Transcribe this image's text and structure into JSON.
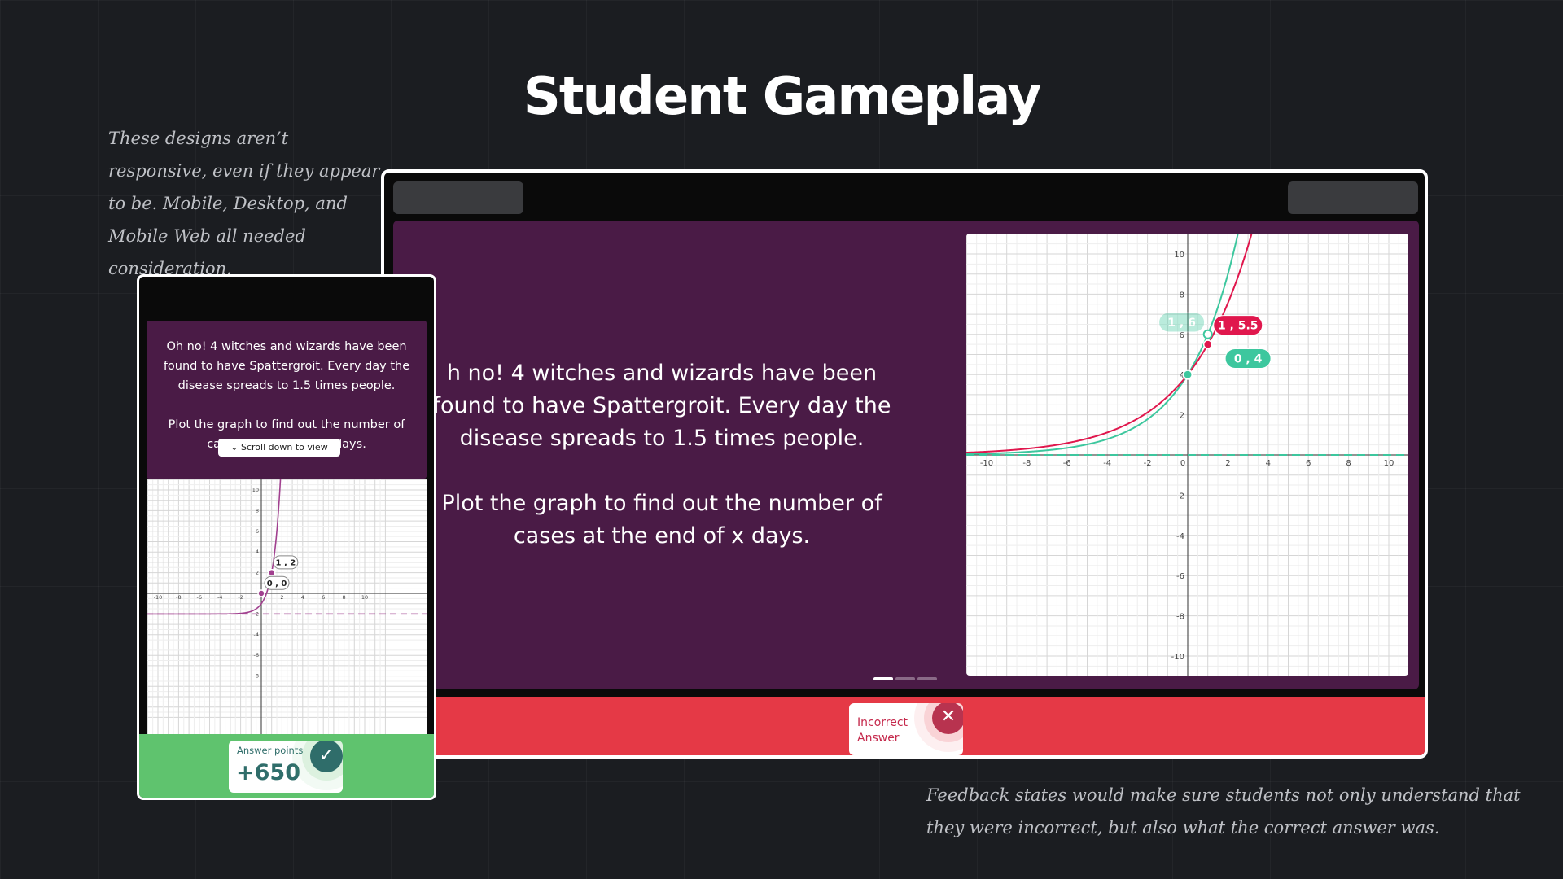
{
  "page": {
    "title": "Student Gameplay",
    "note_top_left": "These designs aren’t responsive, even if they appear to be. Mobile, Desktop, and Mobile Web all needed consideration.",
    "note_bottom_right": "Feedback states would make sure students not only understand that they were incorrect, but also what the correct answer was."
  },
  "desktop": {
    "question": "h no! 4 witches and wizards have been found to have Spattergroit. Every day the disease spreads to 1.5 times people.\n\nPlot the graph to find out the number of cases at the end of x days.",
    "graph": {
      "x_ticks": [
        "-10",
        "-8",
        "-6",
        "-4",
        "-2",
        "0",
        "2",
        "4",
        "6",
        "8",
        "10"
      ],
      "y_ticks": [
        "10",
        "8",
        "6",
        "4",
        "2",
        "-2",
        "-4",
        "-6",
        "-8",
        "-10"
      ],
      "label_correct": "0 , 4",
      "label_student": "1 , 5.5",
      "label_faded": "1 , 6"
    },
    "pagination": {
      "count": 3,
      "active_index": 0
    },
    "feedback": {
      "text": "Incorrect\nAnswer",
      "icon": "close-icon",
      "color": "#e53946"
    }
  },
  "mobile": {
    "question": "Oh no! 4 witches and wizards have been found to have Spattergroit. Every day the disease spreads to 1.5 times people.\n\nPlot the graph to find out the number of cases at the end of x days.",
    "scroll_hint": "Scroll down to view",
    "graph": {
      "x_ticks": [
        "-10",
        "-8",
        "-6",
        "-4",
        "-2",
        "2",
        "4",
        "6",
        "8",
        "10"
      ],
      "y_ticks": [
        "10",
        "8",
        "6",
        "4",
        "2",
        "-2",
        "-4",
        "-6",
        "-8"
      ],
      "label_point1": "1 , 2",
      "label_point2": "0 , 0"
    },
    "feedback": {
      "label": "Answer points",
      "value": "+650",
      "icon": "check-icon",
      "color": "#5fc36e"
    }
  },
  "colors": {
    "panel": "#4a1b46",
    "student_curve": "#e0174d",
    "correct_curve": "#3dc79e",
    "mobile_curve": "#a1408f"
  }
}
